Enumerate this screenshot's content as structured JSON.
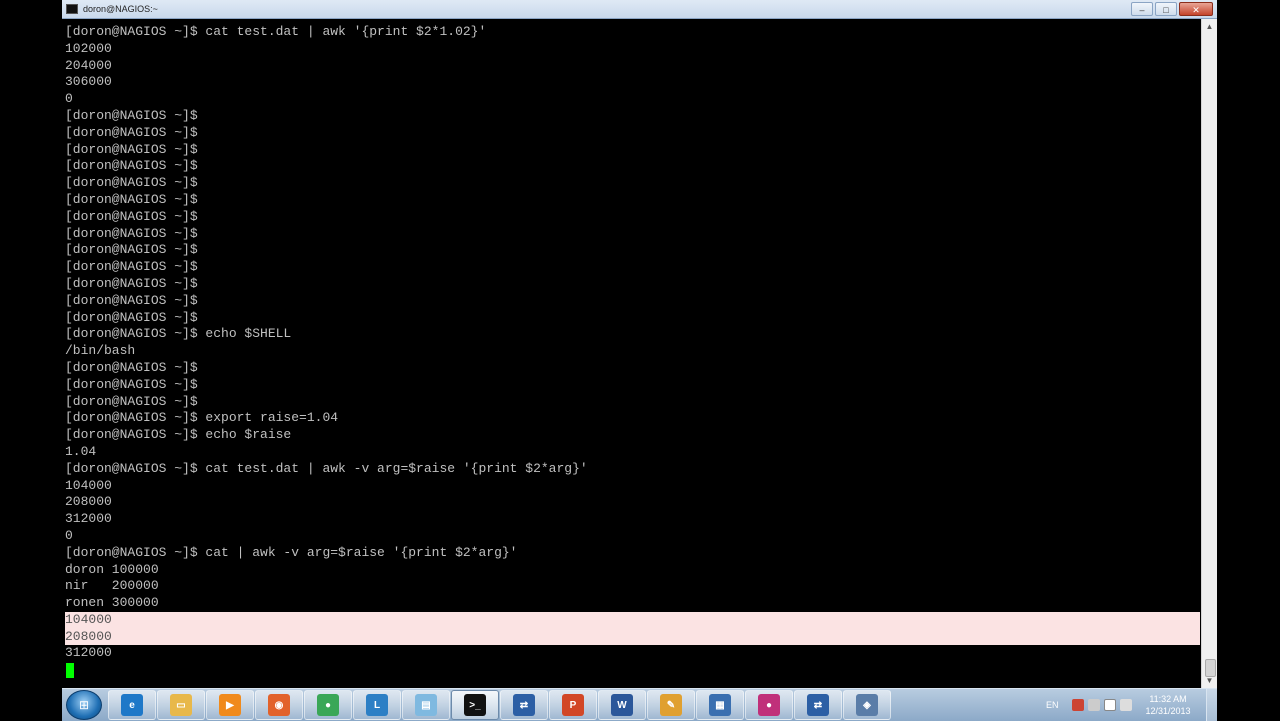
{
  "window": {
    "title": "doron@NAGIOS:~"
  },
  "controls": {
    "minimize": "–",
    "maximize": "□",
    "close": "✕"
  },
  "terminal_lines": [
    "[doron@NAGIOS ~]$ cat test.dat | awk '{print $2*1.02}'",
    "102000",
    "204000",
    "306000",
    "0",
    "[doron@NAGIOS ~]$",
    "[doron@NAGIOS ~]$",
    "[doron@NAGIOS ~]$",
    "[doron@NAGIOS ~]$",
    "[doron@NAGIOS ~]$",
    "[doron@NAGIOS ~]$",
    "[doron@NAGIOS ~]$",
    "[doron@NAGIOS ~]$",
    "[doron@NAGIOS ~]$",
    "[doron@NAGIOS ~]$",
    "[doron@NAGIOS ~]$",
    "[doron@NAGIOS ~]$",
    "[doron@NAGIOS ~]$",
    "[doron@NAGIOS ~]$ echo $SHELL",
    "/bin/bash",
    "[doron@NAGIOS ~]$",
    "[doron@NAGIOS ~]$",
    "[doron@NAGIOS ~]$",
    "[doron@NAGIOS ~]$ export raise=1.04",
    "[doron@NAGIOS ~]$ echo $raise",
    "1.04",
    "[doron@NAGIOS ~]$ cat test.dat | awk -v arg=$raise '{print $2*arg}'",
    "104000",
    "208000",
    "312000",
    "0",
    "[doron@NAGIOS ~]$ cat | awk -v arg=$raise '{print $2*arg}'",
    "doron 100000",
    "nir   200000",
    "ronen 300000",
    "104000",
    "208000",
    "312000"
  ],
  "selected_lines": [
    35,
    36
  ],
  "taskbar": {
    "apps": [
      {
        "name": "internet-explorer-icon",
        "color": "#1e78c8",
        "glyph": "e"
      },
      {
        "name": "file-explorer-icon",
        "color": "#e8b84a",
        "glyph": "▭"
      },
      {
        "name": "media-player-icon",
        "color": "#f08a1c",
        "glyph": "▶"
      },
      {
        "name": "firefox-icon",
        "color": "#e2622b",
        "glyph": "◉"
      },
      {
        "name": "chrome-icon",
        "color": "#3aa757",
        "glyph": "●"
      },
      {
        "name": "lync-icon",
        "color": "#2c7fc5",
        "glyph": "L"
      },
      {
        "name": "notepad-icon",
        "color": "#7fb9e0",
        "glyph": "▤"
      },
      {
        "name": "terminal-icon",
        "color": "#111111",
        "glyph": ">_"
      },
      {
        "name": "network-icon",
        "color": "#2c5fa5",
        "glyph": "⇄"
      },
      {
        "name": "powerpoint-icon",
        "color": "#d24726",
        "glyph": "P"
      },
      {
        "name": "word-icon",
        "color": "#2b579a",
        "glyph": "W"
      },
      {
        "name": "paint-icon",
        "color": "#e0a030",
        "glyph": "✎"
      },
      {
        "name": "movie-maker-icon",
        "color": "#3a6fb0",
        "glyph": "▦"
      },
      {
        "name": "colors-icon",
        "color": "#c0307a",
        "glyph": "●"
      },
      {
        "name": "remote-desktop-icon",
        "color": "#2c5fa5",
        "glyph": "⇄"
      },
      {
        "name": "virtualbox-icon",
        "color": "#5a7da8",
        "glyph": "◈"
      }
    ],
    "active_index": 7,
    "language": "EN",
    "time": "11:32 AM",
    "date": "12/31/2013"
  }
}
